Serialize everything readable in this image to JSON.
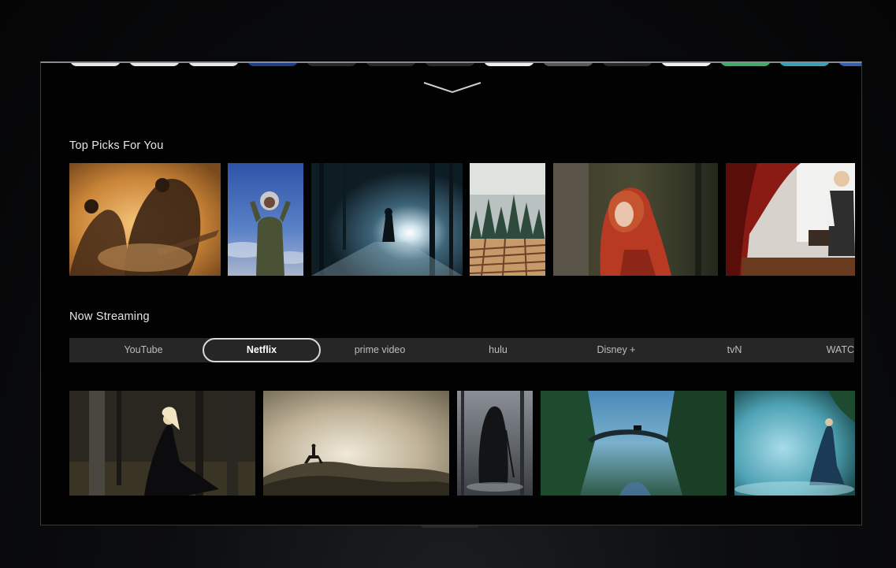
{
  "sections": {
    "top_picks": {
      "title": "Top Picks For You",
      "thumbnails": [
        {
          "name": "desert-aviators"
        },
        {
          "name": "astronaut-girl"
        },
        {
          "name": "foggy-forest-figure"
        },
        {
          "name": "pine-maze"
        },
        {
          "name": "red-hood-girl"
        },
        {
          "name": "girl-reading-window"
        }
      ]
    },
    "now_streaming": {
      "title": "Now Streaming",
      "tabs": [
        {
          "label": "YouTube"
        },
        {
          "label": "Netflix",
          "selected": true
        },
        {
          "label": "prime video"
        },
        {
          "label": "hulu"
        },
        {
          "label": "Disney +"
        },
        {
          "label": "tvN"
        },
        {
          "label": "WATC"
        }
      ],
      "thumbnails": [
        {
          "name": "dark-forest-dancer"
        },
        {
          "name": "rider-on-dunes"
        },
        {
          "name": "hooded-reaper"
        },
        {
          "name": "bridge-valley"
        },
        {
          "name": "mist-lady"
        }
      ]
    }
  },
  "app_row_colors": [
    "#e8e8e8",
    "#e8e8e8",
    "#e8e8e8",
    "#1f3f8a",
    "#2a2a2a",
    "#2a2a2a",
    "#2a2a2a",
    "#f0f0f0",
    "#5a5a5a",
    "#2a2a2a",
    "#f0f0f0",
    "#3faa6a",
    "#3aa0b8",
    "#3a5fb0"
  ],
  "accent_color": "#d8d8d8"
}
